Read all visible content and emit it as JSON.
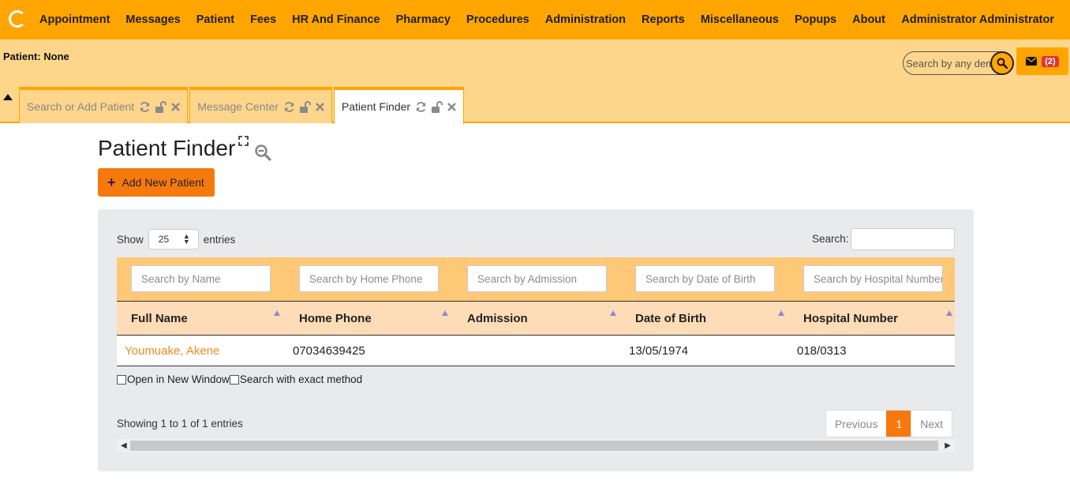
{
  "nav": {
    "items": [
      "Appointment",
      "Messages",
      "Patient",
      "Fees",
      "HR And Finance",
      "Pharmacy",
      "Procedures",
      "Administration",
      "Reports",
      "Miscellaneous",
      "Popups",
      "About"
    ],
    "user": "Administrator Administrator"
  },
  "header": {
    "patient_label": "Patient: None",
    "search_placeholder": "Search by any demographic",
    "mail_badge": "(2)"
  },
  "tabs": [
    {
      "label": "Search or Add Patient",
      "active": false
    },
    {
      "label": "Message Center",
      "active": false
    },
    {
      "label": "Patient Finder",
      "active": true
    }
  ],
  "page": {
    "title": "Patient Finder",
    "add_button": "Add New Patient"
  },
  "table_controls": {
    "show_label": "Show",
    "entries_value": "25",
    "entries_label": "entries",
    "search_label": "Search:"
  },
  "filters": {
    "name": "Search by Name",
    "home_phone": "Search by Home Phone",
    "admission": "Search by Admission",
    "dob": "Search by Date of Birth",
    "hospital_number": "Search by Hospital Number"
  },
  "columns": [
    "Full Name",
    "Home Phone",
    "Admission",
    "Date of Birth",
    "Hospital Number"
  ],
  "rows": [
    {
      "full_name": "Youmuake, Akene",
      "home_phone": "07034639425",
      "admission": "",
      "dob": "13/05/1974",
      "hospital_number": "018/0313"
    }
  ],
  "options": {
    "open_new_window": "Open in New Window",
    "exact_method": "Search with exact method"
  },
  "footer": {
    "showing": "Showing 1 to 1 of 1 entries",
    "previous": "Previous",
    "page": "1",
    "next": "Next"
  },
  "colors": {
    "accent": "#ffa500",
    "button": "#f7790d",
    "link": "#f28a1e"
  }
}
